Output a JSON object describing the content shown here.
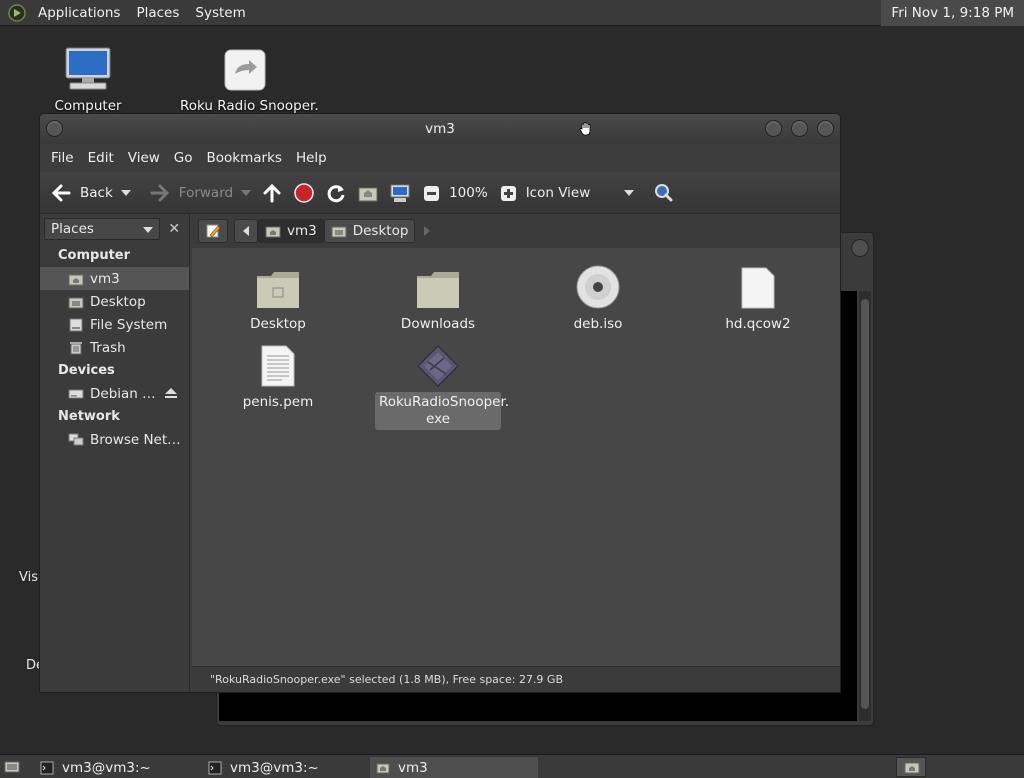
{
  "top_panel": {
    "menus": [
      "Applications",
      "Places",
      "System"
    ],
    "clock": "Fri Nov  1,  9:18 PM"
  },
  "desktop": {
    "icons": [
      {
        "label": "Computer"
      },
      {
        "label": "Roku Radio Snooper."
      }
    ],
    "partial_labels": [
      "Visu",
      "De"
    ]
  },
  "window": {
    "title": "vm3",
    "menu": [
      "File",
      "Edit",
      "View",
      "Go",
      "Bookmarks",
      "Help"
    ],
    "toolbar": {
      "back": "Back",
      "forward": "Forward",
      "zoom": "100%",
      "view_mode": "Icon View"
    },
    "sidebar": {
      "combo": "Places",
      "sections": [
        {
          "heading": "Computer",
          "items": [
            {
              "label": "vm3",
              "icon": "home-icon",
              "selected": true
            },
            {
              "label": "Desktop",
              "icon": "desktop-folder-icon"
            },
            {
              "label": "File System",
              "icon": "drive-icon"
            },
            {
              "label": "Trash",
              "icon": "trash-icon"
            }
          ]
        },
        {
          "heading": "Devices",
          "items": [
            {
              "label": "Debian …",
              "icon": "disk-icon",
              "eject": true
            }
          ]
        },
        {
          "heading": "Network",
          "items": [
            {
              "label": "Browse Net…",
              "icon": "network-icon"
            }
          ]
        }
      ]
    },
    "pathbar": [
      "vm3",
      "Desktop"
    ],
    "files": [
      {
        "name": "Desktop",
        "icon": "desktop-folder-icon"
      },
      {
        "name": "Downloads",
        "icon": "folder-icon"
      },
      {
        "name": "deb.iso",
        "icon": "disc-icon"
      },
      {
        "name": "hd.qcow2",
        "icon": "blank-file-icon"
      },
      {
        "name": "penis.pem",
        "icon": "text-file-icon"
      },
      {
        "name": "RokuRadioSnooper.\nexe",
        "icon": "wine-exe-icon",
        "selected": true
      }
    ],
    "status": "\"RokuRadioSnooper.exe\" selected (1.8 MB), Free space: 27.9 GB"
  },
  "taskbar": {
    "tasks": [
      {
        "label": "vm3@vm3:~",
        "active": false
      },
      {
        "label": "vm3@vm3:~",
        "active": false
      },
      {
        "label": "vm3",
        "active": true
      }
    ]
  }
}
